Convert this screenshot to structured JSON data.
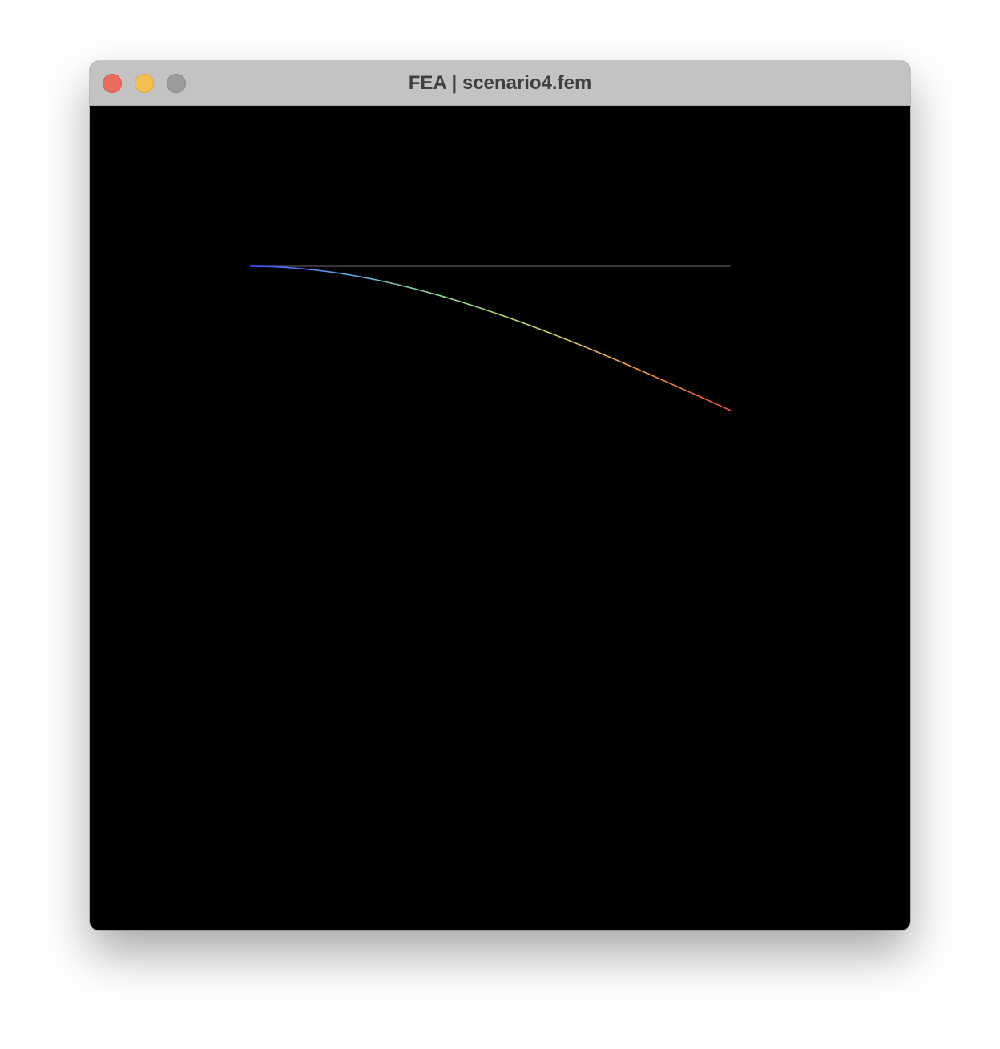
{
  "window": {
    "title": "FEA | scenario4.fem",
    "controls": [
      {
        "name": "close-button",
        "color": "#ec6a5e",
        "border": "#d1584d"
      },
      {
        "name": "minimize-button",
        "color": "#f5bf4f",
        "border": "#d9a63f"
      },
      {
        "name": "zoom-button",
        "color": "#9c9c9c",
        "border": "#878787"
      }
    ]
  },
  "viewport": {
    "background": "#000000",
    "undeformed_color": "#555555",
    "colormap": [
      "#3a4bff",
      "#5fa8f0",
      "#8ce68c",
      "#c9d96a",
      "#f0a040",
      "#ff4a3a"
    ]
  }
}
